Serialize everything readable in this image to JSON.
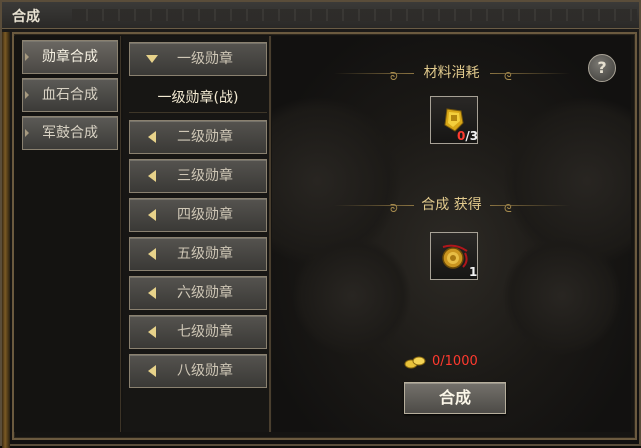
{
  "window": {
    "title": "合成"
  },
  "categories": [
    {
      "label": "勋章合成",
      "active": true
    },
    {
      "label": "血石合成",
      "active": false
    },
    {
      "label": "军鼓合成",
      "active": false
    }
  ],
  "medal_list": {
    "expanded": {
      "label": "一级勋章"
    },
    "selected": "一级勋章(战)",
    "items": [
      {
        "label": "二级勋章"
      },
      {
        "label": "三级勋章"
      },
      {
        "label": "四级勋章"
      },
      {
        "label": "五级勋章"
      },
      {
        "label": "六级勋章"
      },
      {
        "label": "七级勋章"
      },
      {
        "label": "八级勋章"
      }
    ]
  },
  "materials": {
    "title": "材料消耗",
    "item_icon": "gold-medal-fragment-icon",
    "count_have": "0",
    "count_need": "/3"
  },
  "result": {
    "title": "合成 获得",
    "item_icon": "red-ribbon-medal-icon",
    "count": "1"
  },
  "cost": {
    "icon": "gold-ingot-icon",
    "text": "0/1000"
  },
  "craft_button": {
    "label": "合成"
  },
  "help_button": {
    "label": "?"
  },
  "colors": {
    "accent_gold": "#e0c98c",
    "insufficient": "#ff3b2f"
  }
}
